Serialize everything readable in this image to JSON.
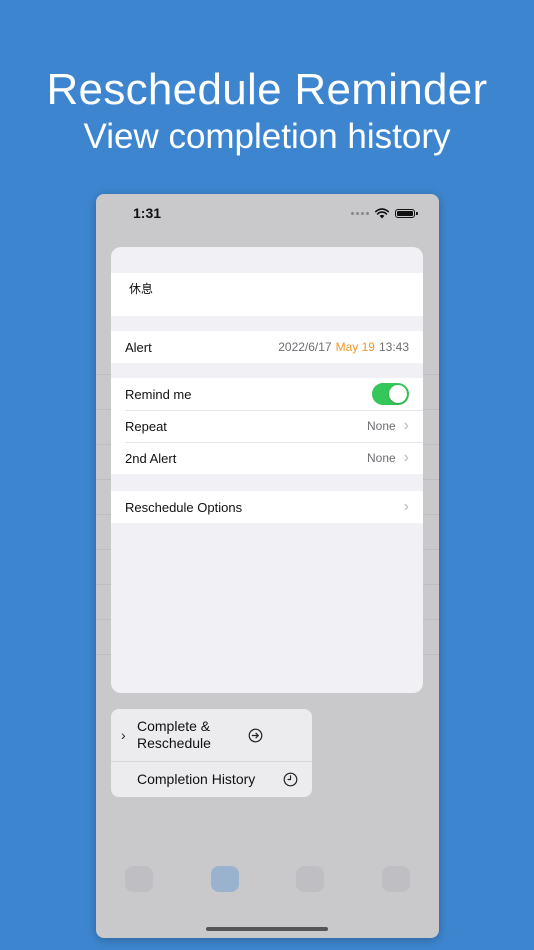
{
  "hero": {
    "title": "Reschedule Reminder",
    "subtitle": "View completion history"
  },
  "status_bar": {
    "time": "1:31"
  },
  "reminder": {
    "title": "休息",
    "alert": {
      "label": "Alert",
      "date_prefix": "2022/6/17",
      "date_highlight": "May 19",
      "time": "13:43",
      "highlight_color": "#f0962c"
    },
    "settings": [
      {
        "label": "Remind me",
        "type": "toggle",
        "on": true
      },
      {
        "label": "Repeat",
        "value": "None"
      },
      {
        "label": "2nd Alert",
        "value": "None"
      }
    ],
    "reschedule_options": {
      "label": "Reschedule Options"
    }
  },
  "context_menu": {
    "items": [
      {
        "label": "Complete & Reschedule",
        "icon": "arrow-right-circle-icon",
        "has_submenu": true
      },
      {
        "label": "Completion History",
        "icon": "clock-icon"
      }
    ]
  },
  "colors": {
    "background": "#3d86cf",
    "toggle_on": "#34c759"
  }
}
